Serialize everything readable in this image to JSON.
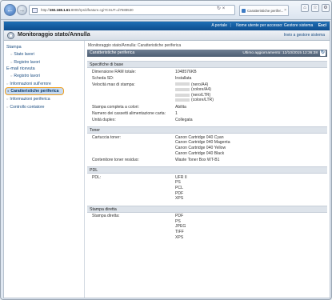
{
  "browser": {
    "url_scheme": "http://",
    "url_host": "192.168.1.61",
    "url_rest": ":8000/rps/dfeature.cgi?CSUT=d7588530",
    "tab_title": "Caratteristiche perifer...",
    "icons": [
      "home-icon",
      "star-icon",
      "gear-icon"
    ]
  },
  "topbar": {
    "portal_link": "A portale",
    "user_label": "Nome utente per accesso: Gestore sistema",
    "logout": "Esci"
  },
  "header": {
    "title": "Monitoraggio stato/Annulla",
    "to_admin": "Invio a gestore sistema"
  },
  "sidebar": {
    "stampa": "Stampa",
    "stato_lavori": "Stato lavori",
    "registro_lavori_1": "Registro lavori",
    "email": "E-mail ricevuta",
    "registro_lavori_2": "Registro lavori",
    "materiali": "Informazioni sull'errore",
    "caratteristiche": "Caratteristiche periferica",
    "info_periferica": "Informazioni periferica",
    "contatore": "Controllo contatore"
  },
  "main": {
    "breadcrumb": "Monitoraggio stato/Annulla: Caratteristiche periferica",
    "page_title": "Caratteristiche periferica",
    "updated": "Ultimo aggiornamento: 12/10/2015 12:36:38",
    "sections": {
      "base": {
        "title": "Specifiche di base",
        "ram_label": "Dimensione RAM totale:",
        "ram_value": "1048576KB",
        "sd_label": "Scheda SD:",
        "sd_value": "Installata",
        "speed_label": "Velocità max di stampa:",
        "speed_v1": "(nero/A4)",
        "speed_v2": "(colore/A4)",
        "speed_v3": "(nero/LTR)",
        "speed_v4": "(colore/LTR)",
        "color_label": "Stampa completa a colori:",
        "color_value": "Abilita",
        "drawers_label": "Numero dei cassetti alimentazione carta:",
        "drawers_value": "1",
        "duplex_label": "Unità duplex:",
        "duplex_value": "Collegata"
      },
      "toner": {
        "title": "Toner",
        "cart_label": "Cartuccia toner:",
        "cart_1": "Canon Cartridge 040 Cyan",
        "cart_2": "Canon Cartridge 040 Magenta",
        "cart_3": "Canon Cartridge 040 Yellow",
        "cart_4": "Canon Cartridge 040 Black",
        "waste_label": "Contenitore toner residuo:",
        "waste_value": "Waste Toner Box WT-B1"
      },
      "pdl": {
        "title": "PDL",
        "label": "PDL:",
        "v1": "UFR II",
        "v2": "PS",
        "v3": "PCL",
        "v4": "PDF",
        "v5": "XPS"
      },
      "direct": {
        "title": "Stampa diretta",
        "label": "Stampa diretta:",
        "v1": "PDF",
        "v2": "PS",
        "v3": "JPEG",
        "v4": "TIFF",
        "v5": "XPS"
      }
    }
  }
}
